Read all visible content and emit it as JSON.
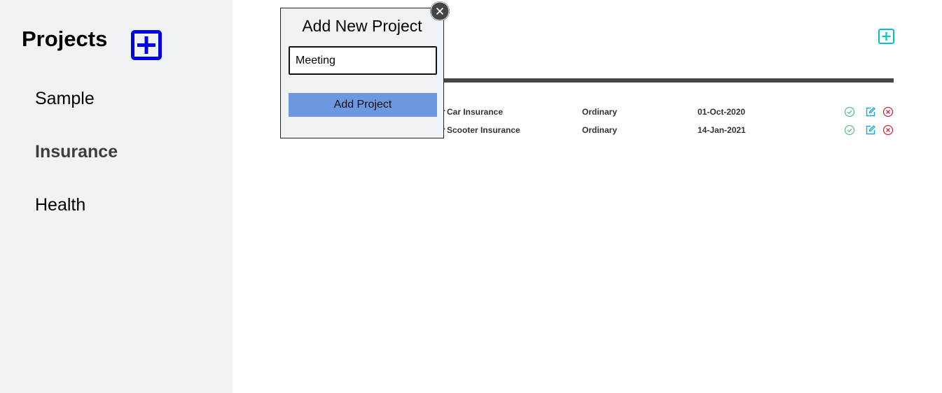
{
  "sidebar": {
    "title": "Projects",
    "add_icon": "plus-square-icon",
    "items": [
      {
        "label": "Sample"
      },
      {
        "label": "Insurance",
        "active": true
      },
      {
        "label": "Health"
      }
    ]
  },
  "main": {
    "add_icon": "plus-square-icon",
    "rows": [
      {
        "name": "Car Insurance",
        "name_prefix": "r",
        "type": "Ordinary",
        "date": "01-Oct-2020"
      },
      {
        "name": "Scooter Insurance",
        "name_prefix": "r",
        "type": "Ordinary",
        "date": "14-Jan-2021"
      }
    ],
    "row_icons": [
      "check-circle-icon",
      "edit-icon",
      "close-circle-icon"
    ]
  },
  "modal": {
    "title": "Add New Project",
    "input_value": "Meeting",
    "button_label": "Add Project",
    "close_icon": "close-icon"
  },
  "colors": {
    "sidebar_bg": "#f0f3f6",
    "sidebar_add_blue": "#0000e6",
    "main_add_teal": "#00c4cc",
    "button_blue": "#6d97df",
    "check_green": "#5cc08a",
    "edit_blue": "#1aa3e8",
    "delete_red": "#d42b3a",
    "divider": "#474747"
  }
}
